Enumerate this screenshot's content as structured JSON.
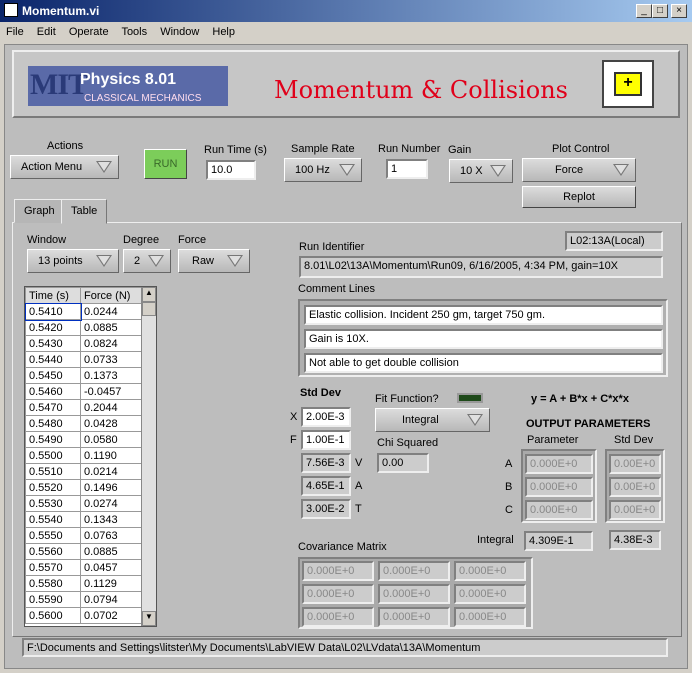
{
  "window": {
    "title": "Momentum.vi",
    "minimize": "_",
    "maximize": "□",
    "close": "×"
  },
  "menu": [
    "File",
    "Edit",
    "Operate",
    "Tools",
    "Window",
    "Help"
  ],
  "header": {
    "logo_mit": "MIT",
    "logo_course": "Physics 8.01",
    "logo_sub": "CLASSICAL MECHANICS",
    "title": "Momentum & Collisions",
    "title_color": "#e0001a"
  },
  "controls": {
    "actions_label": "Actions",
    "actions_value": "Action Menu",
    "run_label": "RUN",
    "run_color": "#7ccd5a",
    "run_time_label": "Run Time (s)",
    "run_time_value": "10.0",
    "sample_rate_label": "Sample Rate",
    "sample_rate_value": "100 Hz",
    "run_number_label": "Run Number",
    "run_number_value": "1",
    "gain_label": "Gain",
    "gain_value": "10 X",
    "plot_control_label": "Plot Control",
    "plot_control_value": "Force",
    "replot_label": "Replot"
  },
  "tabs": [
    {
      "label": "Graph"
    },
    {
      "label": "Table",
      "active": true
    }
  ],
  "table_tab": {
    "window_label": "Window",
    "window_value": "13 points",
    "degree_label": "Degree",
    "degree_value": "2",
    "force_label": "Force",
    "force_value": "Raw",
    "location": "L02:13A(Local)",
    "run_identifier_label": "Run Identifier",
    "run_identifier": "8.01\\L02\\13A\\Momentum\\Run09, 6/16/2005, 4:34 PM, gain=10X",
    "comment_label": "Comment Lines",
    "comments": [
      "Elastic collision. Incident 250 gm, target 750 gm.",
      "Gain is 10X.",
      "Not able to get  double collision"
    ],
    "columns": [
      "Time (s)",
      "Force (N)"
    ],
    "rows": [
      [
        "0.5410",
        "0.0244"
      ],
      [
        "0.5420",
        "0.0885"
      ],
      [
        "0.5430",
        "0.0824"
      ],
      [
        "0.5440",
        "0.0733"
      ],
      [
        "0.5450",
        "0.1373"
      ],
      [
        "0.5460",
        "-0.0457"
      ],
      [
        "0.5470",
        "0.2044"
      ],
      [
        "0.5480",
        "0.0428"
      ],
      [
        "0.5490",
        "0.0580"
      ],
      [
        "0.5500",
        "0.1190"
      ],
      [
        "0.5510",
        "0.0214"
      ],
      [
        "0.5520",
        "0.1496"
      ],
      [
        "0.5530",
        "0.0274"
      ],
      [
        "0.5540",
        "0.1343"
      ],
      [
        "0.5550",
        "0.0763"
      ],
      [
        "0.5560",
        "0.0885"
      ],
      [
        "0.5570",
        "0.0457"
      ],
      [
        "0.5580",
        "0.1129"
      ],
      [
        "0.5590",
        "0.0794"
      ],
      [
        "0.5600",
        "0.0702"
      ]
    ],
    "std_dev_label": "Std Dev",
    "std_dev": [
      {
        "label": "X",
        "value": "2.00E-3",
        "side": "left",
        "editable": true
      },
      {
        "label": "F",
        "value": "1.00E-1",
        "side": "left",
        "editable": true
      },
      {
        "label": "V",
        "value": "7.56E-3",
        "side": "right"
      },
      {
        "label": "A",
        "value": "4.65E-1",
        "side": "right"
      },
      {
        "label": "T",
        "value": "3.00E-2",
        "side": "right"
      }
    ],
    "fit_function_label": "Fit Function?",
    "fit_led": "off",
    "fit_value": "Integral",
    "chi_squared_label": "Chi Squared",
    "chi_squared": "0.00",
    "equation": "y = A + B*x + C*x*x",
    "output_label": "OUTPUT PARAMETERS",
    "parameter_label": "Parameter",
    "std_dev_col_label": "Std Dev",
    "params": [
      {
        "name": "A",
        "value": "0.000E+0",
        "std": "0.00E+0"
      },
      {
        "name": "B",
        "value": "0.000E+0",
        "std": "0.00E+0"
      },
      {
        "name": "C",
        "value": "0.000E+0",
        "std": "0.00E+0"
      }
    ],
    "integral_label": "Integral",
    "integral_value": "4.309E-1",
    "integral_std": "4.38E-3",
    "covariance_label": "Covariance Matrix",
    "covariance": [
      [
        "0.000E+0",
        "0.000E+0",
        "0.000E+0"
      ],
      [
        "0.000E+0",
        "0.000E+0",
        "0.000E+0"
      ],
      [
        "0.000E+0",
        "0.000E+0",
        "0.000E+0"
      ]
    ]
  },
  "status_path": "F:\\Documents and Settings\\litster\\My Documents\\LabVIEW Data\\L02\\LVdata\\13A\\Momentum"
}
